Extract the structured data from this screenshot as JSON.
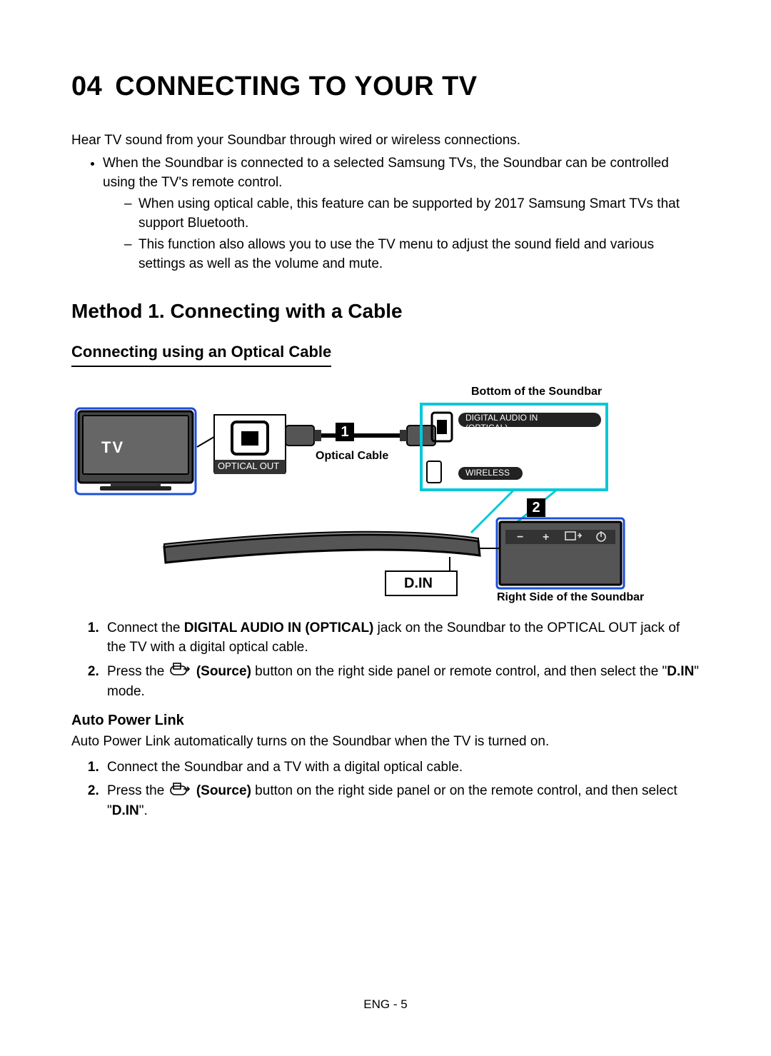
{
  "chapter": {
    "number": "04",
    "title": "CONNECTING TO YOUR TV"
  },
  "intro": "Hear TV sound from your Soundbar through wired or wireless connections.",
  "bullet1": "When the Soundbar is connected to a selected Samsung TVs, the Soundbar can be controlled using the TV's remote control.",
  "dash1": "When using optical cable, this feature can be supported by 2017 Samsung Smart TVs that support Bluetooth.",
  "dash2": "This function also allows you to use the TV menu to adjust the sound field and various settings as well as the volume and mute.",
  "method_heading": "Method 1. Connecting with a Cable",
  "sub_heading": "Connecting using an Optical Cable",
  "diagram": {
    "bottom_label": "Bottom of the Soundbar",
    "tv_label": "TV",
    "optical_out": "OPTICAL OUT",
    "optical_cable": "Optical Cable",
    "digital_audio_in": "DIGITAL AUDIO IN\n(OPTICAL)",
    "wireless": "WIRELESS",
    "step1": "1",
    "step2": "2",
    "d_in": "D.IN",
    "right_side_label": "Right Side of the Soundbar"
  },
  "steps": {
    "s1_a": "Connect the ",
    "s1_b": "DIGITAL AUDIO IN (OPTICAL)",
    "s1_c": " jack on the Soundbar to the OPTICAL OUT jack of the TV with a digital optical cable.",
    "s2_a": "Press the ",
    "s2_b": "(Source)",
    "s2_c": " button on the right side panel or remote control, and then select the \"",
    "s2_d": "D.IN",
    "s2_e": "\" mode."
  },
  "auto_power": {
    "heading": "Auto Power Link",
    "intro": "Auto Power Link automatically turns on the Soundbar when the TV is turned on.",
    "s1": "Connect the Soundbar and a TV with a digital optical cable.",
    "s2_a": "Press the ",
    "s2_b": "(Source)",
    "s2_c": " button on the right side panel or on the remote control, and then select \"",
    "s2_d": "D.IN",
    "s2_e": "\"."
  },
  "footer": "ENG - 5"
}
